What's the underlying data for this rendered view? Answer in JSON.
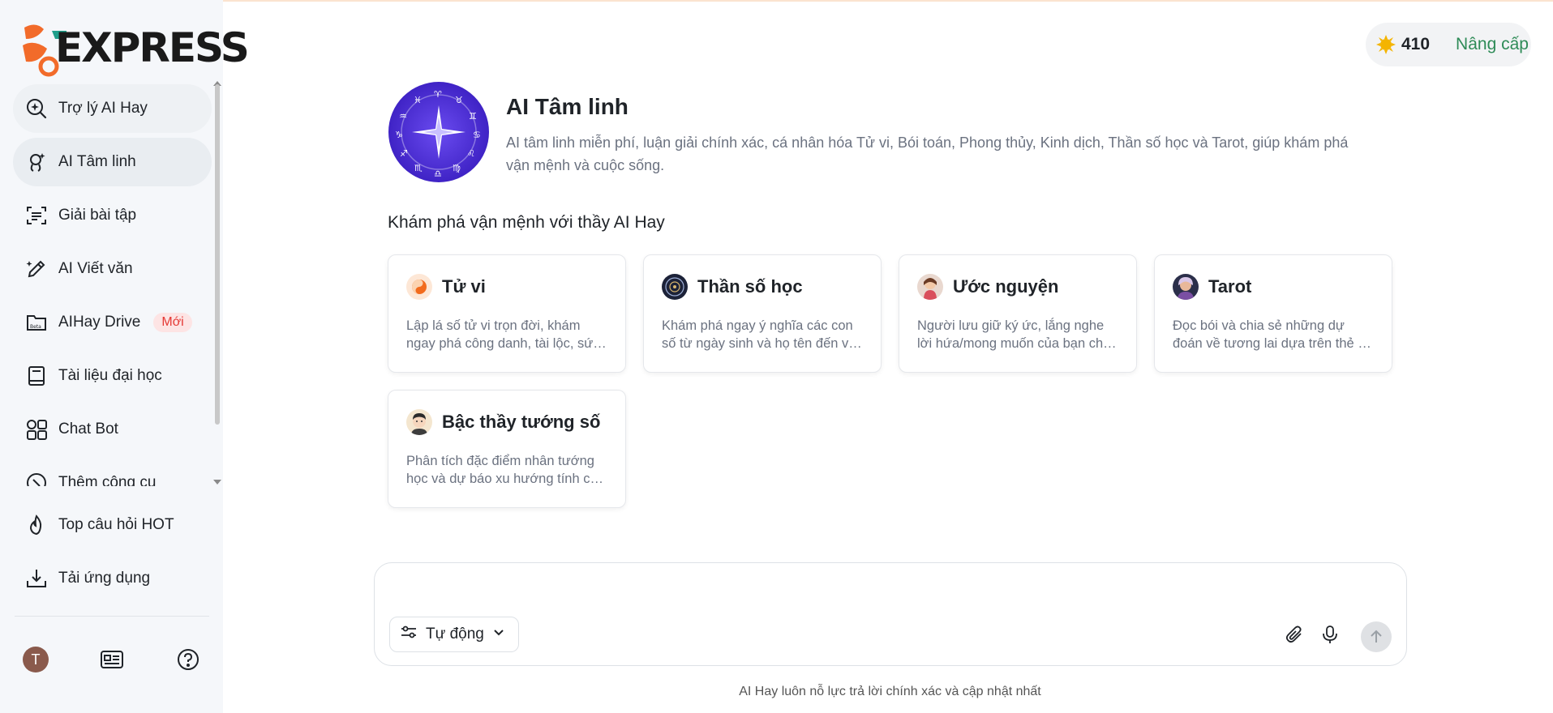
{
  "brand": {
    "logo_text": "EXPRESS"
  },
  "sidebar": {
    "items": [
      {
        "label": "Trợ lý AI Hay",
        "icon": "ai-search-icon"
      },
      {
        "label": "AI Tâm linh",
        "icon": "spiritual-icon"
      },
      {
        "label": "Giải bài tập",
        "icon": "scan-doc-icon"
      },
      {
        "label": "AI Viết văn",
        "icon": "pen-sparkle-icon"
      },
      {
        "label": "AIHay Drive",
        "icon": "drive-folder-icon",
        "badge": "Mới"
      },
      {
        "label": "Tài liệu đại học",
        "icon": "book-icon"
      },
      {
        "label": "Chat Bot",
        "icon": "apps-grid-icon"
      },
      {
        "label": "Thêm công cụ",
        "icon": "compass-icon"
      }
    ],
    "bottom_items": [
      {
        "label": "Top câu hỏi HOT",
        "icon": "fire-icon"
      },
      {
        "label": "Tải ứng dụng",
        "icon": "download-icon"
      }
    ],
    "avatar_initial": "T"
  },
  "credits": {
    "count": "410",
    "upgrade_label": "Nâng cấp"
  },
  "hero": {
    "title": "AI Tâm linh",
    "description": "AI tâm linh miễn phí, luận giải chính xác, cá nhân hóa Tử vi, Bói toán, Phong thủy, Kinh dịch, Thần số học và Tarot, giúp khám phá vận mệnh và cuộc sống."
  },
  "section_title": "Khám phá vận mệnh với thầy AI Hay",
  "cards": [
    {
      "title": "Tử vi",
      "line1": "Lập lá số tử vi trọn đời, khám",
      "line2": "ngay phá công danh, tài lộc, sức khỏe..."
    },
    {
      "title": "Thần số học",
      "line1": "Khám phá ngay ý nghĩa các con",
      "line2": "số từ ngày sinh và họ tên đến vận mệnh..."
    },
    {
      "title": "Ước nguyện",
      "line1": "Người lưu giữ ký ức, lắng nghe",
      "line2": "lời hứa/mong muốn của bạn cho tương lai..."
    },
    {
      "title": "Tarot",
      "line1": "Đọc bói và chia sẻ những dự",
      "line2": "đoán về tương lai dựa trên thẻ bài..."
    },
    {
      "title": "Bậc thầy tướng số",
      "line1": "Phân tích đặc điểm nhân tướng",
      "line2": "học và dự báo xu hướng tính cách..."
    }
  ],
  "composer": {
    "mode_label": "Tự động"
  },
  "footer_note": "AI Hay luôn nỗ lực trả lời chính xác và cập nhật nhất",
  "colors": {
    "accent_green": "#2e8b57",
    "badge_red": "#e53935",
    "hero_purple": "#4b2fd0"
  }
}
